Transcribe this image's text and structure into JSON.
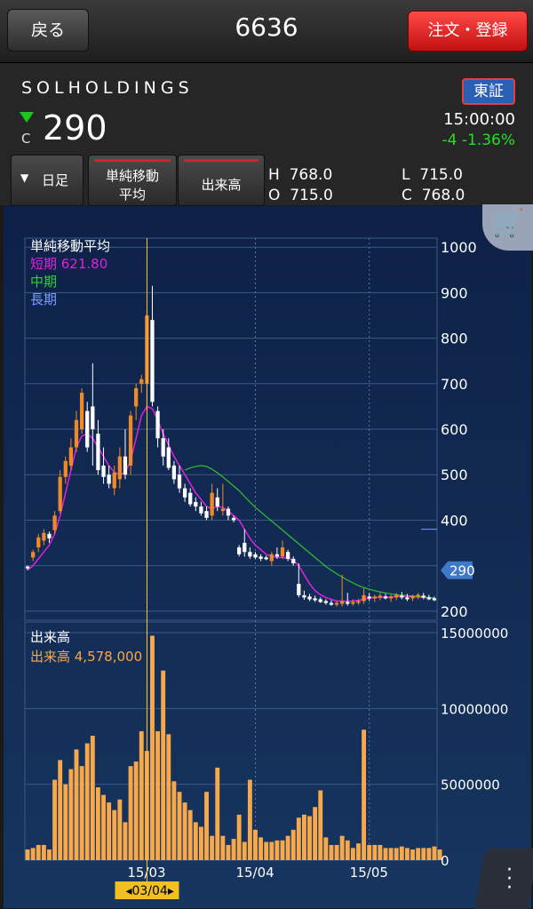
{
  "header": {
    "back_label": "戻る",
    "title": "6636",
    "order_label": "注文・登録"
  },
  "stock": {
    "company": "SOLHOLDINGS",
    "market_badge": "東証",
    "direction_icon": "down-triangle-icon",
    "close_marker": "C",
    "price": "290",
    "time": "15:00:00",
    "change": "-4  -1.36%"
  },
  "toolbar": {
    "period_label": "日足",
    "ma_label_1": "単純移動",
    "ma_label_2": "平均",
    "volume_label": "出来高"
  },
  "ohlc": {
    "H": "768.0",
    "L": "715.0",
    "O": "715.0",
    "C": "768.0",
    "H_label": "H",
    "L_label": "L",
    "O_label": "O",
    "C_label": "C"
  },
  "legend": {
    "title": "単純移動平均",
    "short": "短期 621.80",
    "mid": "中期",
    "long": "長期",
    "vol_title": "出来高",
    "vol_value": "出来高 4,578,000"
  },
  "price_axis": [
    "1000",
    "900",
    "800",
    "700",
    "600",
    "500",
    "400",
    "200"
  ],
  "current_tag": "290",
  "vol_axis": [
    "15000000",
    "10000000",
    "5000000",
    "0"
  ],
  "x_labels": [
    "15/03",
    "15/04",
    "15/05"
  ],
  "cursor_label": "03/04",
  "colors": {
    "up": "#f08a28",
    "down": "#ffffff",
    "short_ma": "#e020e0",
    "mid_ma": "#30c030",
    "long_ma": "#7aa0ff",
    "volume": "#f7a84a",
    "bg": "#0f2a50"
  },
  "chart_data": {
    "type": "candlestick",
    "price_ylim": [
      180,
      1020
    ],
    "volume_ylim": [
      0,
      15000000
    ],
    "candles": [
      {
        "o": 298,
        "h": 300,
        "l": 290,
        "c": 294
      },
      {
        "o": 318,
        "h": 335,
        "l": 310,
        "c": 330
      },
      {
        "o": 340,
        "h": 370,
        "l": 330,
        "c": 362
      },
      {
        "o": 355,
        "h": 380,
        "l": 345,
        "c": 372
      },
      {
        "o": 370,
        "h": 375,
        "l": 350,
        "c": 360
      },
      {
        "o": 378,
        "h": 420,
        "l": 370,
        "c": 410
      },
      {
        "o": 420,
        "h": 510,
        "l": 415,
        "c": 495
      },
      {
        "o": 495,
        "h": 540,
        "l": 480,
        "c": 530
      },
      {
        "o": 520,
        "h": 580,
        "l": 510,
        "c": 560
      },
      {
        "o": 560,
        "h": 640,
        "l": 550,
        "c": 620
      },
      {
        "o": 600,
        "h": 690,
        "l": 590,
        "c": 680
      },
      {
        "o": 640,
        "h": 660,
        "l": 550,
        "c": 560
      },
      {
        "o": 650,
        "h": 745,
        "l": 520,
        "c": 600
      },
      {
        "o": 590,
        "h": 620,
        "l": 500,
        "c": 510
      },
      {
        "o": 520,
        "h": 560,
        "l": 480,
        "c": 495
      },
      {
        "o": 500,
        "h": 520,
        "l": 470,
        "c": 480
      },
      {
        "o": 470,
        "h": 520,
        "l": 455,
        "c": 505
      },
      {
        "o": 490,
        "h": 560,
        "l": 470,
        "c": 540
      },
      {
        "o": 540,
        "h": 600,
        "l": 490,
        "c": 500
      },
      {
        "o": 520,
        "h": 640,
        "l": 500,
        "c": 630
      },
      {
        "o": 650,
        "h": 700,
        "l": 620,
        "c": 690
      },
      {
        "o": 700,
        "h": 720,
        "l": 680,
        "c": 710
      },
      {
        "o": 700,
        "h": 860,
        "l": 640,
        "c": 850
      },
      {
        "o": 840,
        "h": 915,
        "l": 650,
        "c": 660
      },
      {
        "o": 640,
        "h": 650,
        "l": 560,
        "c": 580
      },
      {
        "o": 580,
        "h": 600,
        "l": 520,
        "c": 540
      },
      {
        "o": 560,
        "h": 580,
        "l": 510,
        "c": 515
      },
      {
        "o": 520,
        "h": 530,
        "l": 480,
        "c": 490
      },
      {
        "o": 500,
        "h": 520,
        "l": 460,
        "c": 470
      },
      {
        "o": 470,
        "h": 480,
        "l": 440,
        "c": 450
      },
      {
        "o": 460,
        "h": 470,
        "l": 430,
        "c": 435
      },
      {
        "o": 440,
        "h": 450,
        "l": 420,
        "c": 430
      },
      {
        "o": 430,
        "h": 440,
        "l": 410,
        "c": 415
      },
      {
        "o": 420,
        "h": 430,
        "l": 400,
        "c": 405
      },
      {
        "o": 410,
        "h": 480,
        "l": 400,
        "c": 460
      },
      {
        "o": 450,
        "h": 470,
        "l": 420,
        "c": 430
      },
      {
        "o": 420,
        "h": 480,
        "l": 410,
        "c": 425
      },
      {
        "o": 425,
        "h": 430,
        "l": 400,
        "c": 410
      },
      {
        "o": 405,
        "h": 410,
        "l": 395,
        "c": 400
      },
      {
        "o": 340,
        "h": 345,
        "l": 320,
        "c": 325
      },
      {
        "o": 350,
        "h": 380,
        "l": 320,
        "c": 330
      },
      {
        "o": 330,
        "h": 340,
        "l": 315,
        "c": 320
      },
      {
        "o": 325,
        "h": 330,
        "l": 315,
        "c": 318
      },
      {
        "o": 320,
        "h": 325,
        "l": 310,
        "c": 315
      },
      {
        "o": 318,
        "h": 322,
        "l": 312,
        "c": 316
      },
      {
        "o": 310,
        "h": 330,
        "l": 300,
        "c": 325
      },
      {
        "o": 325,
        "h": 340,
        "l": 315,
        "c": 320
      },
      {
        "o": 320,
        "h": 355,
        "l": 315,
        "c": 340
      },
      {
        "o": 330,
        "h": 335,
        "l": 310,
        "c": 315
      },
      {
        "o": 315,
        "h": 320,
        "l": 300,
        "c": 305
      },
      {
        "o": 260,
        "h": 305,
        "l": 230,
        "c": 235
      },
      {
        "o": 235,
        "h": 245,
        "l": 225,
        "c": 230
      },
      {
        "o": 232,
        "h": 238,
        "l": 222,
        "c": 226
      },
      {
        "o": 228,
        "h": 234,
        "l": 220,
        "c": 224
      },
      {
        "o": 226,
        "h": 230,
        "l": 218,
        "c": 220
      },
      {
        "o": 222,
        "h": 226,
        "l": 214,
        "c": 218
      },
      {
        "o": 218,
        "h": 224,
        "l": 212,
        "c": 216
      },
      {
        "o": 215,
        "h": 222,
        "l": 210,
        "c": 218
      },
      {
        "o": 216,
        "h": 280,
        "l": 210,
        "c": 222
      },
      {
        "o": 220,
        "h": 240,
        "l": 212,
        "c": 218
      },
      {
        "o": 218,
        "h": 226,
        "l": 212,
        "c": 220
      },
      {
        "o": 220,
        "h": 226,
        "l": 214,
        "c": 222
      },
      {
        "o": 222,
        "h": 250,
        "l": 216,
        "c": 235
      },
      {
        "o": 232,
        "h": 240,
        "l": 222,
        "c": 228
      },
      {
        "o": 228,
        "h": 236,
        "l": 220,
        "c": 232
      },
      {
        "o": 230,
        "h": 240,
        "l": 224,
        "c": 234
      },
      {
        "o": 232,
        "h": 238,
        "l": 226,
        "c": 230
      },
      {
        "o": 228,
        "h": 236,
        "l": 220,
        "c": 232
      },
      {
        "o": 230,
        "h": 240,
        "l": 224,
        "c": 236
      },
      {
        "o": 234,
        "h": 242,
        "l": 226,
        "c": 230
      },
      {
        "o": 230,
        "h": 238,
        "l": 222,
        "c": 228
      },
      {
        "o": 228,
        "h": 236,
        "l": 222,
        "c": 234
      },
      {
        "o": 232,
        "h": 240,
        "l": 226,
        "c": 236
      },
      {
        "o": 234,
        "h": 240,
        "l": 226,
        "c": 230
      },
      {
        "o": 230,
        "h": 236,
        "l": 224,
        "c": 228
      },
      {
        "o": 228,
        "h": 232,
        "l": 222,
        "c": 226
      }
    ],
    "short_ma": [
      290,
      300,
      315,
      330,
      345,
      370,
      410,
      460,
      510,
      560,
      585,
      590,
      580,
      560,
      540,
      520,
      505,
      500,
      505,
      530,
      580,
      630,
      650,
      645,
      620,
      590,
      565,
      540,
      520,
      500,
      480,
      460,
      445,
      430,
      425,
      430,
      428,
      420,
      410,
      400,
      380,
      360,
      345,
      335,
      325,
      320,
      318,
      318,
      316,
      312,
      300,
      280,
      260,
      245,
      236,
      230,
      226,
      222,
      222,
      222,
      222,
      224,
      226,
      228,
      230,
      230,
      231,
      231,
      232,
      232,
      232,
      232,
      231,
      230,
      229,
      228
    ],
    "mid_ma": {
      "start_index": 29,
      "values": [
        510,
        515,
        518,
        520,
        518,
        512,
        504,
        495,
        485,
        475,
        465,
        452,
        440,
        428,
        418,
        408,
        398,
        388,
        378,
        368,
        358,
        348,
        338,
        328,
        318,
        308,
        298,
        290,
        282,
        275,
        268,
        262,
        256,
        252,
        248,
        245,
        242,
        240,
        238,
        236,
        235,
        234,
        233,
        232,
        231,
        230,
        229
      ]
    },
    "volume": [
      0.7,
      0.8,
      1.0,
      1.0,
      0.7,
      5.3,
      6.6,
      5.0,
      6.0,
      7.3,
      6.2,
      7.7,
      8.2,
      4.8,
      4.3,
      3.8,
      3.3,
      4.0,
      2.5,
      6.2,
      6.5,
      8.5,
      7.2,
      14.8,
      8.5,
      12.5,
      8.3,
      5.2,
      4.5,
      3.8,
      3.3,
      2.5,
      2.2,
      4.5,
      1.6,
      6.1,
      1.6,
      1.0,
      1.4,
      3.0,
      1.2,
      5.3,
      2.0,
      1.5,
      1.2,
      1.2,
      1.3,
      1.3,
      1.6,
      2.0,
      2.8,
      3.0,
      2.9,
      3.5,
      4.6,
      1.5,
      1.0,
      1.0,
      1.6,
      1.3,
      0.8,
      1.1,
      1.3,
      1.0,
      1.0,
      1.0,
      0.8,
      0.8,
      0.8,
      0.9,
      0.8,
      0.7,
      0.8,
      0.8,
      0.8,
      0.9,
      0.7
    ],
    "volume_unit": "millions",
    "spike_volume": {
      "index": 62,
      "value": 8.6
    }
  }
}
